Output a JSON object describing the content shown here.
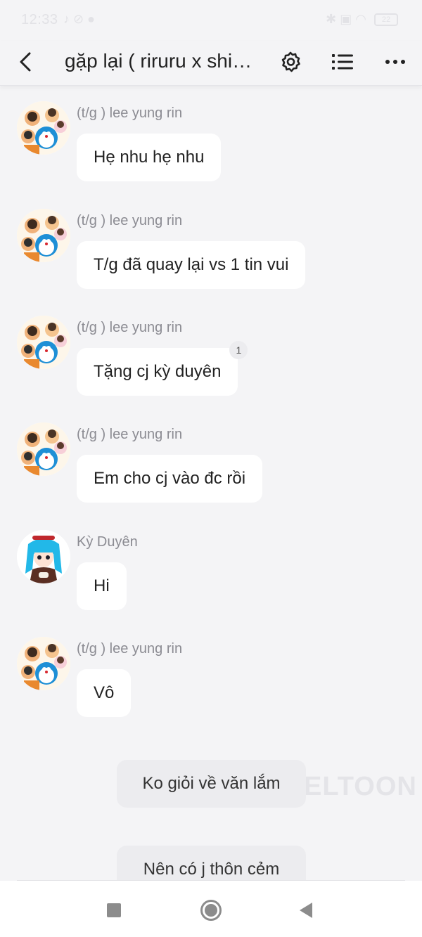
{
  "status_bar": {
    "time": "12:33",
    "battery": "22"
  },
  "header": {
    "title": "gặp lại ( riruru x shi…"
  },
  "messages": [
    {
      "sender": "(t/g ) lee yung rin",
      "text": "Hẹ nhu hẹ nhu"
    },
    {
      "sender": "(t/g ) lee yung rin",
      "text": "T/g đã quay lại vs 1 tin vui"
    },
    {
      "sender": "(t/g ) lee yung rin",
      "text": "Tặng cj kỳ duyên",
      "badge": "1"
    },
    {
      "sender": "(t/g ) lee yung rin",
      "text": "Em cho cj vào đc rồi"
    },
    {
      "sender": "Kỳ Duyên",
      "text": "Hi"
    },
    {
      "sender": "(t/g ) lee yung rin",
      "text": "Vô"
    }
  ],
  "narration": [
    {
      "text": "Ko giỏi về văn lắm"
    },
    {
      "text": "Nên có j thôn cẻm"
    }
  ],
  "watermark": "ELTOON",
  "colors": {
    "background": "#f4f4f6",
    "bubble": "#ffffff",
    "narration_bubble": "#ececef",
    "sender_text": "#8b8b92"
  }
}
